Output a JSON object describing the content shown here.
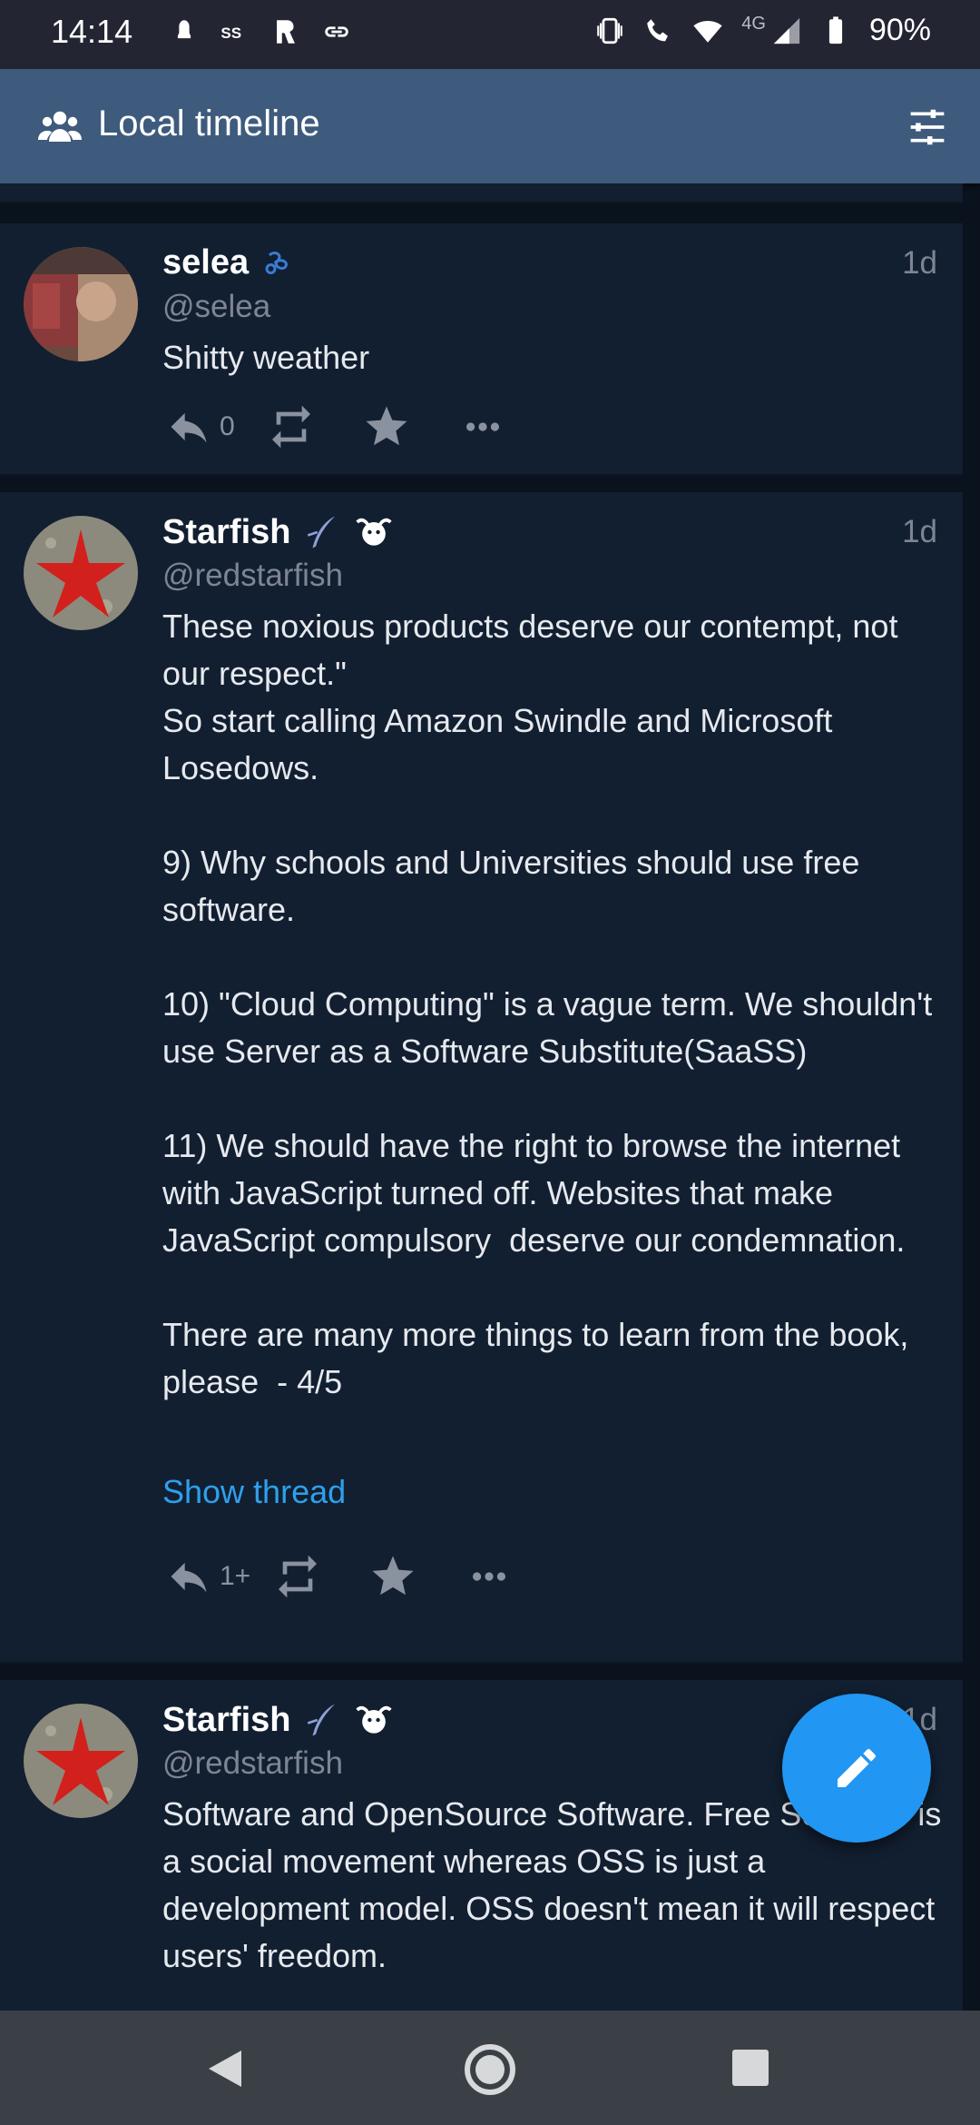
{
  "status_bar": {
    "time": "14:14",
    "battery": "90%",
    "network": "4G",
    "left_icons": [
      "notification-icon",
      "ss-icon",
      "app-icon",
      "link-icon"
    ],
    "right_icons": [
      "vibrate-icon",
      "wifi-call-icon",
      "wifi-icon",
      "signal-icon",
      "battery-icon"
    ]
  },
  "app_bar": {
    "title": "Local timeline",
    "left_icon": "group-icon",
    "right_icon": "filter-settings-icon"
  },
  "posts": [
    {
      "display_name": "selea",
      "handle": "@selea",
      "time": "1d",
      "content": "Shitty weather",
      "reply_count": "0",
      "badges": [
        "emoji-badge"
      ]
    },
    {
      "display_name": "Starfish",
      "handle": "@redstarfish",
      "time": "1d",
      "content": "These noxious products deserve our contempt, not our respect.\"\nSo start calling Amazon Swindle and Microsoft Losedows.\n\n9) Why schools and Universities should use free software.\n\n10) \"Cloud Computing\" is a vague term. We shouldn't use Server as a Software Substitute(SaaSS)\n\n11) We should have the right to browse the internet with JavaScript turned off. Websites that make JavaScript compulsory  deserve our condemnation.\n\nThere are many more things to learn from the book, please  - 4/5",
      "show_thread": "Show thread",
      "reply_count": "1+",
      "badges": [
        "feather-badge",
        "gnu-badge"
      ]
    },
    {
      "display_name": "Starfish",
      "handle": "@redstarfish",
      "time": "1d",
      "content": "Software and OpenSource Software. Free Software is a social movement whereas OSS is just a development model. OSS doesn't mean it will respect users' freedom.",
      "badges": [
        "feather-badge",
        "gnu-badge"
      ]
    }
  ],
  "fab": {
    "icon": "pencil-icon",
    "color": "#2196f3"
  },
  "nav_bar": {
    "icons": [
      "back-icon",
      "home-icon",
      "recents-icon"
    ]
  },
  "colors": {
    "app_bar": "#3e5b7d",
    "post_bg": "#121f30",
    "link": "#2ea0ec",
    "background": "#0a121d"
  }
}
